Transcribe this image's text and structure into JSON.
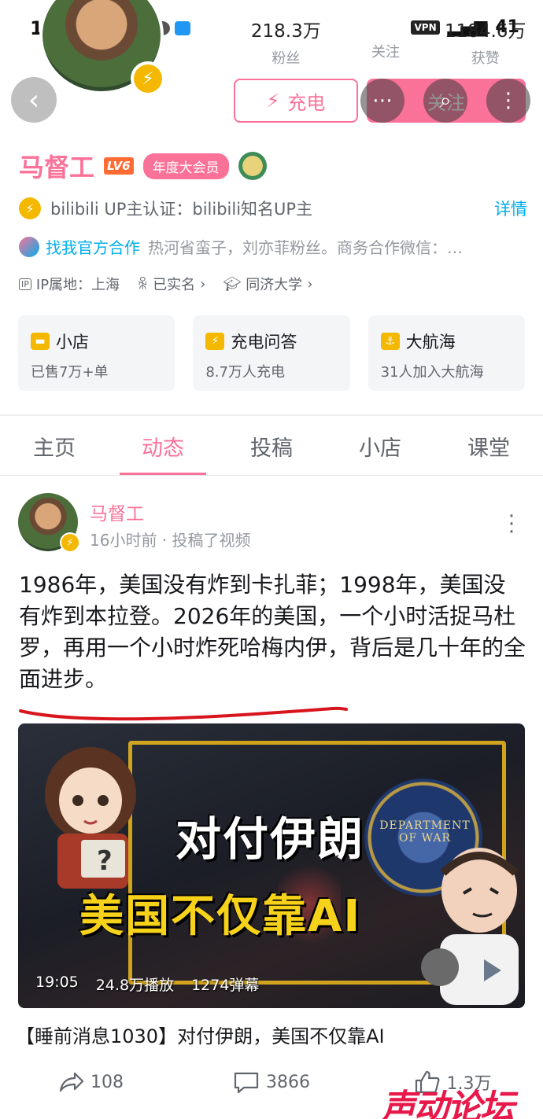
{
  "status_bar": {
    "time": "10:27",
    "vpn": "VPN",
    "battery": "41"
  },
  "profile": {
    "name": "马督工",
    "level": "LV6",
    "vip_badge": "年度大会员",
    "fans_count": "218.3万",
    "fans_label": "粉丝",
    "following_label": "关注",
    "likes_count": "1184.6万",
    "likes_label": "获赞",
    "charge_label": "充电",
    "follow_label": "关注",
    "verify_text": "bilibili UP主认证：bilibili知名UP主",
    "details_label": "详情",
    "coop_link": "找我官方合作",
    "coop_text": "热河省蛮子，刘亦菲粉丝。商务合作微信：…",
    "ip_tag": "IP",
    "ip_location": "IP属地：上海",
    "real_name": "已实名",
    "school": "同济大学"
  },
  "cards": [
    {
      "title": "小店",
      "subtitle": "已售7万+单"
    },
    {
      "title": "充电问答",
      "subtitle": "8.7万人充电"
    },
    {
      "title": "大航海",
      "subtitle": "31人加入大航海"
    }
  ],
  "tabs": [
    "主页",
    "动态",
    "投稿",
    "小店",
    "课堂"
  ],
  "post": {
    "author": "马督工",
    "time": "16小时前 · 投稿了视频",
    "text": "1986年，美国没有炸到卡扎菲；1998年，美国没有炸到本拉登。2026年的美国，一个小时活捉马杜罗，再用一个小时炸死哈梅内伊，背后是几十年的全面进步。",
    "video": {
      "thumb_line1": "对付伊朗",
      "thumb_line2": "美国不仅靠AI",
      "seal_text": "DEPARTMENT OF WAR",
      "duration": "19:05",
      "views": "24.8万播放",
      "danmaku": "1274弹幕"
    },
    "video_title": "【睡前消息1030】对付伊朗，美国不仅靠AI",
    "shares": "108",
    "comments": "3866",
    "likes": "1.3万"
  },
  "watermark": "声动论坛",
  "colors": {
    "accent": "#fb7299",
    "link": "#00aeec",
    "bolt": "#f5b800"
  }
}
